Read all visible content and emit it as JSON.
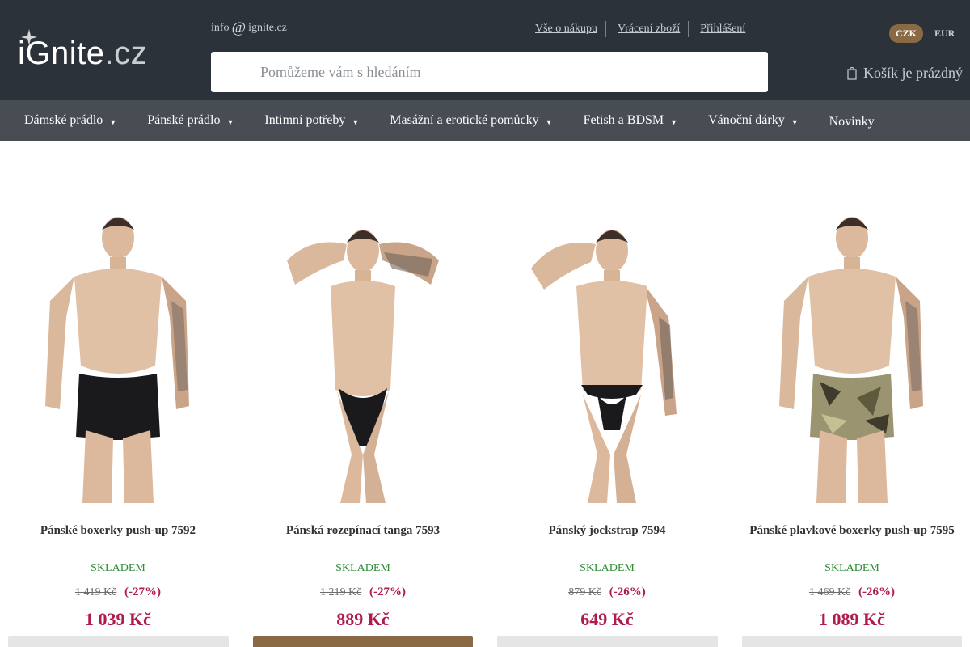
{
  "header": {
    "logo_main": "iGnite",
    "logo_domain": ".cz",
    "email_user": "info",
    "email_at": "@",
    "email_domain": "ignite.cz",
    "links": [
      "Vše o nákupu",
      "Vrácení zboží",
      "Přihlášení"
    ],
    "search_placeholder": "Pomůžeme vám s hledáním",
    "currencies": [
      "CZK",
      "EUR"
    ],
    "active_currency": "CZK",
    "cart_label": "Košík je prázdný",
    "cart_icon": "cart-icon"
  },
  "nav": {
    "items": [
      {
        "label": "Dámské prádlo",
        "arrow": "▼"
      },
      {
        "label": "Pánské prádlo",
        "arrow": "▼"
      },
      {
        "label": "Intimní potřeby",
        "arrow": "▼"
      },
      {
        "label": "Masážní a erotické pomůcky",
        "arrow": "▼"
      },
      {
        "label": "Fetish a BDSM",
        "arrow": "▼"
      },
      {
        "label": "Vánoční dárky",
        "arrow": "▼"
      },
      {
        "label": "Novinky",
        "arrow": ""
      }
    ]
  },
  "products": [
    {
      "name": "Pánské boxerky push-up 7592",
      "stock": "SKLADEM",
      "old_price": "1 419 Kč",
      "discount": "(-27%)",
      "price": "1 039 Kč",
      "garment": "black-boxer"
    },
    {
      "name": "Pánská rozepínací tanga 7593",
      "stock": "SKLADEM",
      "old_price": "1 219 Kč",
      "discount": "(-27%)",
      "price": "889 Kč",
      "garment": "black-thong"
    },
    {
      "name": "Pánský jockstrap 7594",
      "stock": "SKLADEM",
      "old_price": "879 Kč",
      "discount": "(-26%)",
      "price": "649 Kč",
      "garment": "black-jockstrap"
    },
    {
      "name": "Pánské plavkové boxerky push-up 7595",
      "stock": "SKLADEM",
      "old_price": "1 469 Kč",
      "discount": "(-26%)",
      "price": "1 089 Kč",
      "garment": "camo-boxer"
    }
  ],
  "colors": {
    "header_bg": "#2c3239",
    "nav_bg": "#474d53",
    "accent": "#8a6a44",
    "price": "#b01b4f",
    "stock": "#2e8b37"
  }
}
